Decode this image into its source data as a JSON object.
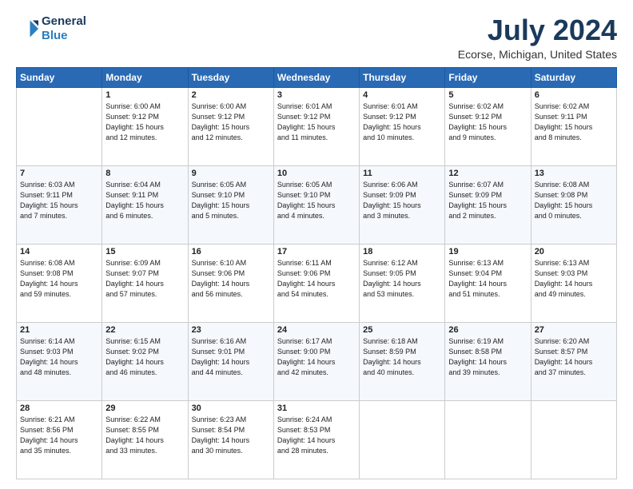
{
  "header": {
    "logo_line1": "General",
    "logo_line2": "Blue",
    "title": "July 2024",
    "subtitle": "Ecorse, Michigan, United States"
  },
  "calendar": {
    "days_of_week": [
      "Sunday",
      "Monday",
      "Tuesday",
      "Wednesday",
      "Thursday",
      "Friday",
      "Saturday"
    ],
    "weeks": [
      [
        {
          "day": "",
          "info": ""
        },
        {
          "day": "1",
          "info": "Sunrise: 6:00 AM\nSunset: 9:12 PM\nDaylight: 15 hours\nand 12 minutes."
        },
        {
          "day": "2",
          "info": "Sunrise: 6:00 AM\nSunset: 9:12 PM\nDaylight: 15 hours\nand 12 minutes."
        },
        {
          "day": "3",
          "info": "Sunrise: 6:01 AM\nSunset: 9:12 PM\nDaylight: 15 hours\nand 11 minutes."
        },
        {
          "day": "4",
          "info": "Sunrise: 6:01 AM\nSunset: 9:12 PM\nDaylight: 15 hours\nand 10 minutes."
        },
        {
          "day": "5",
          "info": "Sunrise: 6:02 AM\nSunset: 9:12 PM\nDaylight: 15 hours\nand 9 minutes."
        },
        {
          "day": "6",
          "info": "Sunrise: 6:02 AM\nSunset: 9:11 PM\nDaylight: 15 hours\nand 8 minutes."
        }
      ],
      [
        {
          "day": "7",
          "info": "Sunrise: 6:03 AM\nSunset: 9:11 PM\nDaylight: 15 hours\nand 7 minutes."
        },
        {
          "day": "8",
          "info": "Sunrise: 6:04 AM\nSunset: 9:11 PM\nDaylight: 15 hours\nand 6 minutes."
        },
        {
          "day": "9",
          "info": "Sunrise: 6:05 AM\nSunset: 9:10 PM\nDaylight: 15 hours\nand 5 minutes."
        },
        {
          "day": "10",
          "info": "Sunrise: 6:05 AM\nSunset: 9:10 PM\nDaylight: 15 hours\nand 4 minutes."
        },
        {
          "day": "11",
          "info": "Sunrise: 6:06 AM\nSunset: 9:09 PM\nDaylight: 15 hours\nand 3 minutes."
        },
        {
          "day": "12",
          "info": "Sunrise: 6:07 AM\nSunset: 9:09 PM\nDaylight: 15 hours\nand 2 minutes."
        },
        {
          "day": "13",
          "info": "Sunrise: 6:08 AM\nSunset: 9:08 PM\nDaylight: 15 hours\nand 0 minutes."
        }
      ],
      [
        {
          "day": "14",
          "info": "Sunrise: 6:08 AM\nSunset: 9:08 PM\nDaylight: 14 hours\nand 59 minutes."
        },
        {
          "day": "15",
          "info": "Sunrise: 6:09 AM\nSunset: 9:07 PM\nDaylight: 14 hours\nand 57 minutes."
        },
        {
          "day": "16",
          "info": "Sunrise: 6:10 AM\nSunset: 9:06 PM\nDaylight: 14 hours\nand 56 minutes."
        },
        {
          "day": "17",
          "info": "Sunrise: 6:11 AM\nSunset: 9:06 PM\nDaylight: 14 hours\nand 54 minutes."
        },
        {
          "day": "18",
          "info": "Sunrise: 6:12 AM\nSunset: 9:05 PM\nDaylight: 14 hours\nand 53 minutes."
        },
        {
          "day": "19",
          "info": "Sunrise: 6:13 AM\nSunset: 9:04 PM\nDaylight: 14 hours\nand 51 minutes."
        },
        {
          "day": "20",
          "info": "Sunrise: 6:13 AM\nSunset: 9:03 PM\nDaylight: 14 hours\nand 49 minutes."
        }
      ],
      [
        {
          "day": "21",
          "info": "Sunrise: 6:14 AM\nSunset: 9:03 PM\nDaylight: 14 hours\nand 48 minutes."
        },
        {
          "day": "22",
          "info": "Sunrise: 6:15 AM\nSunset: 9:02 PM\nDaylight: 14 hours\nand 46 minutes."
        },
        {
          "day": "23",
          "info": "Sunrise: 6:16 AM\nSunset: 9:01 PM\nDaylight: 14 hours\nand 44 minutes."
        },
        {
          "day": "24",
          "info": "Sunrise: 6:17 AM\nSunset: 9:00 PM\nDaylight: 14 hours\nand 42 minutes."
        },
        {
          "day": "25",
          "info": "Sunrise: 6:18 AM\nSunset: 8:59 PM\nDaylight: 14 hours\nand 40 minutes."
        },
        {
          "day": "26",
          "info": "Sunrise: 6:19 AM\nSunset: 8:58 PM\nDaylight: 14 hours\nand 39 minutes."
        },
        {
          "day": "27",
          "info": "Sunrise: 6:20 AM\nSunset: 8:57 PM\nDaylight: 14 hours\nand 37 minutes."
        }
      ],
      [
        {
          "day": "28",
          "info": "Sunrise: 6:21 AM\nSunset: 8:56 PM\nDaylight: 14 hours\nand 35 minutes."
        },
        {
          "day": "29",
          "info": "Sunrise: 6:22 AM\nSunset: 8:55 PM\nDaylight: 14 hours\nand 33 minutes."
        },
        {
          "day": "30",
          "info": "Sunrise: 6:23 AM\nSunset: 8:54 PM\nDaylight: 14 hours\nand 30 minutes."
        },
        {
          "day": "31",
          "info": "Sunrise: 6:24 AM\nSunset: 8:53 PM\nDaylight: 14 hours\nand 28 minutes."
        },
        {
          "day": "",
          "info": ""
        },
        {
          "day": "",
          "info": ""
        },
        {
          "day": "",
          "info": ""
        }
      ]
    ]
  }
}
